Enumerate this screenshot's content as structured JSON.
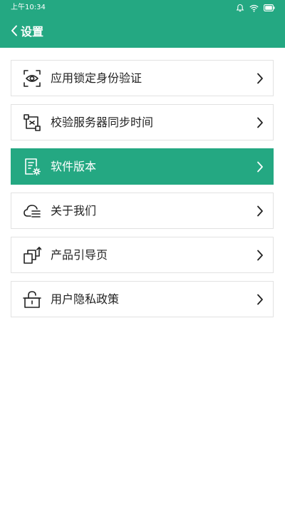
{
  "status_bar": {
    "time": "上午10:34",
    "icons": [
      "alarm-icon",
      "wifi-icon",
      "battery-icon"
    ]
  },
  "header": {
    "title": "设置",
    "back_icon": "chevron-left-icon"
  },
  "menu": {
    "items": [
      {
        "label": "应用锁定身份验证",
        "icon": "eye-scan-icon",
        "active": false
      },
      {
        "label": "校验服务器同步时间",
        "icon": "sync-time-icon",
        "active": false
      },
      {
        "label": "软件版本",
        "icon": "document-gear-icon",
        "active": true
      },
      {
        "label": "关于我们",
        "icon": "cloud-lines-icon",
        "active": false
      },
      {
        "label": "产品引导页",
        "icon": "pages-arrow-icon",
        "active": false
      },
      {
        "label": "用户隐私政策",
        "icon": "lock-icon",
        "active": false
      }
    ]
  },
  "colors": {
    "primary": "#24a882",
    "border": "#e2e2e2",
    "text": "#222222"
  }
}
